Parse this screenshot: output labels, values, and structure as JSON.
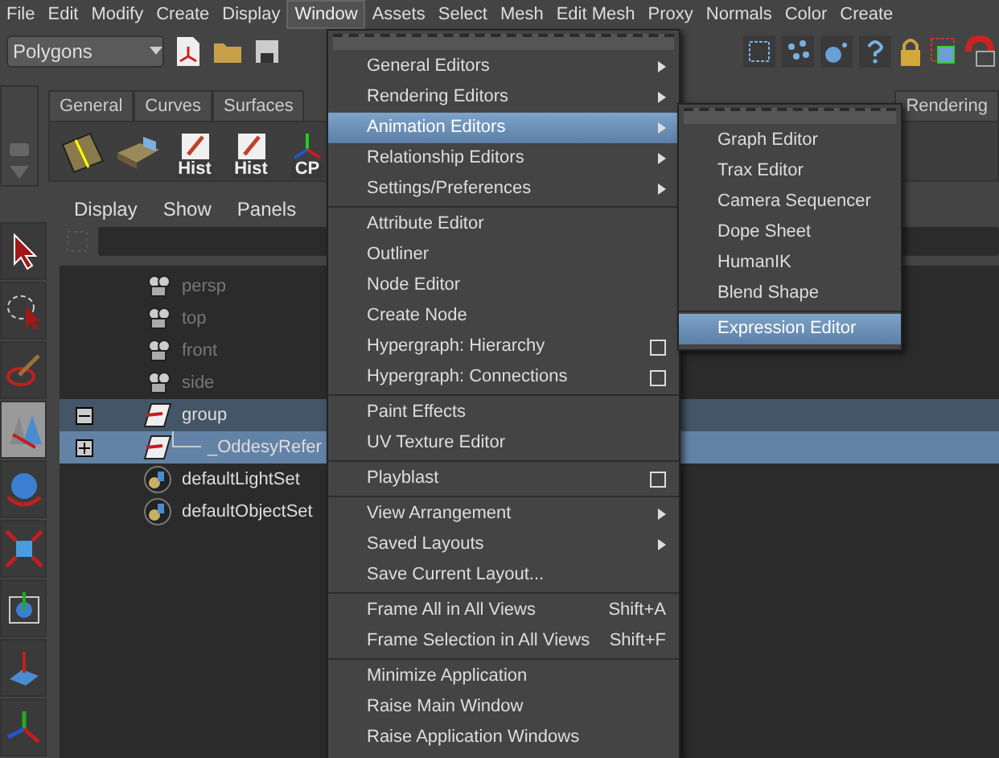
{
  "menu_bar": [
    {
      "label": "File",
      "selected": false
    },
    {
      "label": "Edit",
      "selected": false
    },
    {
      "label": "Modify",
      "selected": false
    },
    {
      "label": "Create",
      "selected": false
    },
    {
      "label": "Display",
      "selected": false
    },
    {
      "label": "Window",
      "selected": true
    },
    {
      "label": "Assets",
      "selected": false
    },
    {
      "label": "Select",
      "selected": false
    },
    {
      "label": "Mesh",
      "selected": false
    },
    {
      "label": "Edit Mesh",
      "selected": false
    },
    {
      "label": "Proxy",
      "selected": false
    },
    {
      "label": "Normals",
      "selected": false
    },
    {
      "label": "Color",
      "selected": false
    },
    {
      "label": "Create",
      "selected": false
    }
  ],
  "toolbar": {
    "menu_set": "Polygons"
  },
  "shelf": {
    "tabs": [
      {
        "label": "General",
        "selected": false
      },
      {
        "label": "Curves",
        "selected": false
      },
      {
        "label": "Surfaces",
        "selected": false
      },
      {
        "label": "Rendering",
        "selected": false
      }
    ],
    "buttons": [
      {
        "kind": "plane"
      },
      {
        "kind": "cube"
      },
      {
        "kind": "note",
        "label": "Hist"
      },
      {
        "kind": "note",
        "label": "Hist"
      },
      {
        "kind": "axes",
        "label": "CP"
      }
    ]
  },
  "tools": [
    {
      "kind": "select",
      "selected": false
    },
    {
      "kind": "lasso",
      "selected": false
    },
    {
      "kind": "paint",
      "selected": false
    },
    {
      "kind": "last",
      "selected": true
    },
    {
      "kind": "rotate",
      "selected": false
    },
    {
      "kind": "scale",
      "selected": false
    },
    {
      "kind": "manip",
      "selected": false
    },
    {
      "kind": "soft",
      "selected": false
    },
    {
      "kind": "move",
      "selected": false
    }
  ],
  "outliner": {
    "menu": [
      "Display",
      "Show",
      "Panels"
    ],
    "rows": [
      {
        "name": "persp",
        "kind": "camera",
        "dimmed": true
      },
      {
        "name": "top",
        "kind": "camera",
        "dimmed": true
      },
      {
        "name": "front",
        "kind": "camera",
        "dimmed": true
      },
      {
        "name": "side",
        "kind": "camera",
        "dimmed": true
      },
      {
        "name": "group",
        "kind": "transform",
        "expanded": true,
        "selected": false,
        "highlighted": true,
        "children": [
          {
            "name": "_OddesyRefer",
            "kind": "transform",
            "expanded": false,
            "selected": true
          }
        ]
      },
      {
        "name": "defaultLightSet",
        "kind": "set"
      },
      {
        "name": "defaultObjectSet",
        "kind": "set"
      }
    ]
  },
  "window_menu": {
    "sections": [
      [
        {
          "label": "General Editors",
          "submenu": true
        },
        {
          "label": "Rendering Editors",
          "submenu": true
        },
        {
          "label": "Animation Editors",
          "submenu": true,
          "selected": true
        },
        {
          "label": "Relationship Editors",
          "submenu": true
        },
        {
          "label": "Settings/Preferences",
          "submenu": true
        }
      ],
      [
        {
          "label": "Attribute Editor"
        },
        {
          "label": "Outliner"
        },
        {
          "label": "Node Editor"
        },
        {
          "label": "Create Node"
        },
        {
          "label": "Hypergraph: Hierarchy",
          "option_box": true
        },
        {
          "label": "Hypergraph: Connections",
          "option_box": true
        }
      ],
      [
        {
          "label": "Paint Effects"
        },
        {
          "label": "UV Texture Editor"
        }
      ],
      [
        {
          "label": "Playblast",
          "option_box": true
        }
      ],
      [
        {
          "label": "View Arrangement",
          "submenu": true
        },
        {
          "label": "Saved Layouts",
          "submenu": true
        },
        {
          "label": "Save Current Layout..."
        }
      ],
      [
        {
          "label": "Frame All in All Views",
          "shortcut": "Shift+A"
        },
        {
          "label": "Frame Selection in All Views",
          "shortcut": "Shift+F"
        }
      ],
      [
        {
          "label": "Minimize Application"
        },
        {
          "label": "Raise Main Window"
        },
        {
          "label": "Raise Application Windows"
        }
      ]
    ]
  },
  "animation_editors_menu": {
    "sections": [
      [
        {
          "label": "Graph Editor",
          "selected": false
        },
        {
          "label": "Trax Editor",
          "selected": false
        },
        {
          "label": "Camera Sequencer",
          "selected": false
        },
        {
          "label": "Dope Sheet",
          "selected": false
        },
        {
          "label": "HumanIK",
          "selected": false
        },
        {
          "label": "Blend Shape",
          "selected": false
        }
      ],
      [
        {
          "label": "Expression Editor",
          "selected": true
        }
      ]
    ]
  }
}
